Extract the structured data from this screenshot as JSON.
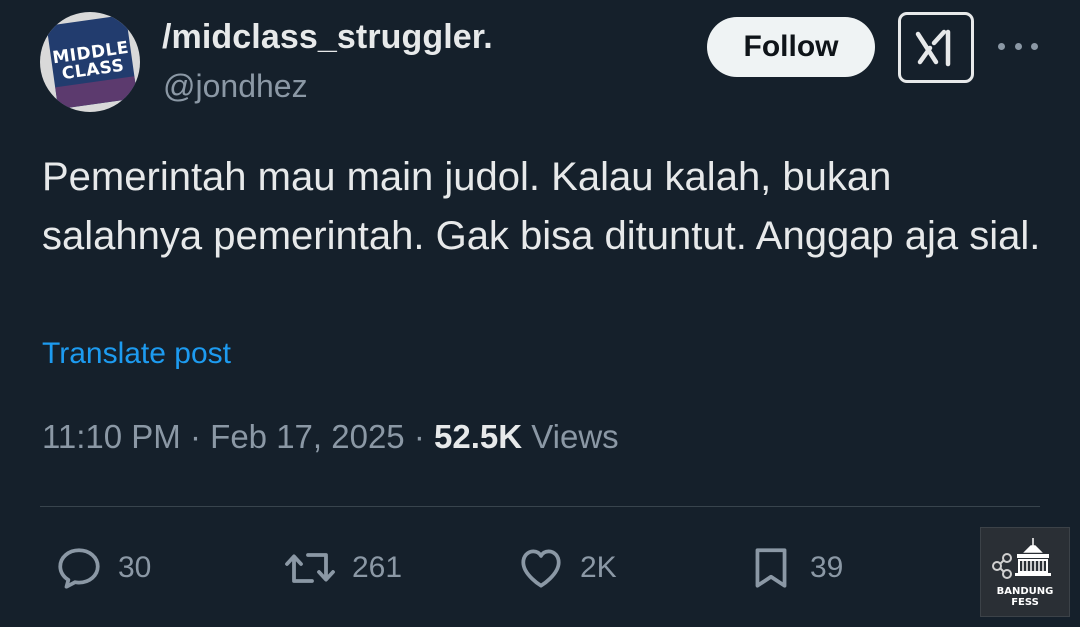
{
  "user": {
    "display_name": "/midclass_struggler.",
    "handle": "@jondhez",
    "avatar_text": [
      "MIDDLE",
      "CLASS"
    ]
  },
  "actions_top": {
    "follow_label": "Follow",
    "grok_icon": "grok-icon",
    "more_icon": "more-horizontal-icon"
  },
  "post": {
    "text": "Pemerintah mau main judol. Kalau kalah, bukan salahnya pemerintah. Gak bisa dituntut. Anggap aja sial.",
    "translate_label": "Translate post",
    "time": "11:10 PM",
    "date": "Feb 17, 2025",
    "views_count": "52.5K",
    "views_label": "Views"
  },
  "engagement": {
    "replies": "30",
    "reposts": "261",
    "likes": "2K",
    "bookmarks": "39"
  },
  "watermark": {
    "line1": "BANDUNG",
    "line2": "FESS"
  },
  "colors": {
    "background": "#15202b",
    "text_primary": "#e7e9ea",
    "text_secondary": "#8b98a5",
    "link": "#1d9bf0",
    "divider": "#38444d"
  }
}
